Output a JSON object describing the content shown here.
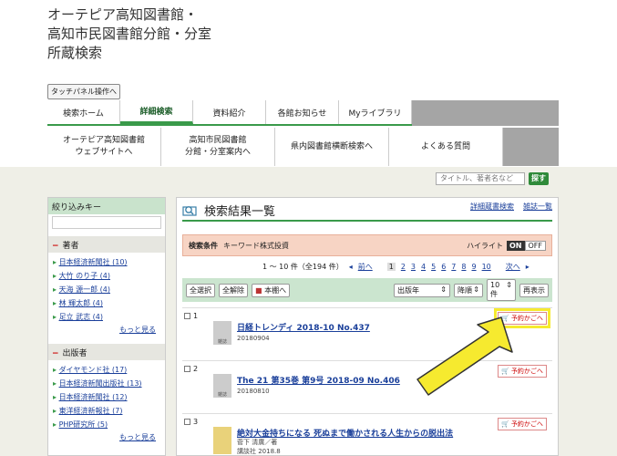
{
  "site_title": [
    "オーテピア高知図書館・",
    "高知市民図書館分館・分室",
    "所蔵検索"
  ],
  "touch_panel": "タッチパネル操作へ",
  "nav1": [
    "検索ホーム",
    "詳細検索",
    "資料紹介",
    "各館お知らせ",
    "Myライブラリ"
  ],
  "nav2": [
    "オーテピア高知図書館\nウェブサイトへ",
    "高知市民図書館\n分館・分室案内へ",
    "県内図書館横断検索へ",
    "よくある質問"
  ],
  "quick_search": {
    "placeholder": "タイトル、著者名など",
    "button": "探す"
  },
  "sidebar": {
    "header": "絞り込みキー",
    "sections": [
      {
        "title": "著者",
        "items": [
          "大竹 のり子 (4)",
          "天海 源一郎 (4)",
          "林 輝太郎 (4)",
          "足立 武志 (4)"
        ],
        "first": "日本経済新聞社 (10)",
        "more": "もっと見る"
      },
      {
        "title": "出版者",
        "items": [
          "日本経済新聞出版社 (13)",
          "日本経済新聞社 (12)",
          "東洋経済新報社 (7)",
          "PHP研究所 (5)"
        ],
        "first": "ダイヤモンド社 (17)",
        "more": "もっと見る"
      }
    ]
  },
  "results": {
    "heading": "検索結果一覧",
    "links": [
      "詳細蔵書検索",
      "雑誌一覧"
    ],
    "condition_label": "検索条件",
    "condition": "キーワード株式投資",
    "highlight": "ハイライト",
    "on": "ON",
    "off": "OFF",
    "range": "1 〜 10 件（全194 件）",
    "prev": "前へ",
    "pages": [
      "1",
      "2",
      "3",
      "4",
      "5",
      "6",
      "7",
      "8",
      "9",
      "10"
    ],
    "next": "次へ",
    "toolbar": {
      "select_all": "全選択",
      "deselect_all": "全解除",
      "bookshelf": "本棚へ",
      "sort": "出版年",
      "order": "降順",
      "count": "10件",
      "redisplay": "再表示"
    },
    "reserve": "予約かごへ",
    "thumb_label": "雑誌",
    "items": [
      {
        "num": "1",
        "title": "日経トレンディ 2018-10 No.437",
        "line1": "20180904",
        "line2": ""
      },
      {
        "num": "2",
        "title": "The 21 第35巻 第9号 2018-09 No.406",
        "line1": "20180810",
        "line2": ""
      },
      {
        "num": "3",
        "title": "絶対大金持ちになる 死ぬまで働かされる人生からの脱出法",
        "line1": "菅下 清廣／著",
        "line2": "講談社 2018.8"
      }
    ]
  },
  "colors": {
    "accent": "#3a9a4a",
    "highlight": "#f6ea2f",
    "footer_bg": "#efefe7"
  }
}
